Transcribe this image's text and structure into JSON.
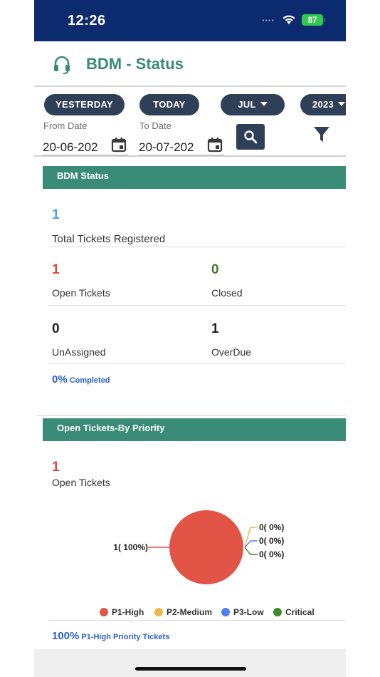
{
  "status_bar": {
    "time": "12:26",
    "battery": "87"
  },
  "app_bar": {
    "title": "BDM - Status",
    "icon": "headset-icon"
  },
  "filters": {
    "yesterday_label": "YESTERDAY",
    "today_label": "TODAY",
    "month_label": "JUL",
    "year_label": "2023",
    "from_label": "From Date",
    "from_value": "20-06-202",
    "to_label": "To Date",
    "to_value": "20-07-202"
  },
  "bdm_status": {
    "header": "BDM Status",
    "total_value": "1",
    "total_label": "Total Tickets Registered",
    "open_value": "1",
    "open_label": "Open Tickets",
    "closed_value": "0",
    "closed_label": "Closed",
    "unassigned_value": "0",
    "unassigned_label": "UnAssigned",
    "overdue_value": "1",
    "overdue_label": "OverDue",
    "completed_pct": "0%",
    "completed_label": "Completed"
  },
  "priority": {
    "header": "Open Tickets-By Priority",
    "open_value": "1",
    "open_label": "Open Tickets",
    "summary_pct": "100%",
    "summary_label": "P1-High Priority Tickets"
  },
  "colors": {
    "header_bg": "#3a8c76",
    "pill_bg": "#2e3f57",
    "red": "#e0473b",
    "green": "#3c7d22",
    "blue_link": "#2a5fd1",
    "light_blue": "#4aa3e0"
  },
  "chart_data": {
    "type": "pie",
    "categories": [
      "P1-High",
      "P2-Medium",
      "P3-Low",
      "Critical"
    ],
    "values": [
      1,
      0,
      0,
      0
    ],
    "labels": [
      "1( 100%)",
      "0( 0%)",
      "0( 0%)",
      "0( 0%)"
    ],
    "colors": [
      "#e25446",
      "#e9b949",
      "#4f7ff0",
      "#3d8a2a"
    ],
    "legend_placement": "bottom"
  }
}
